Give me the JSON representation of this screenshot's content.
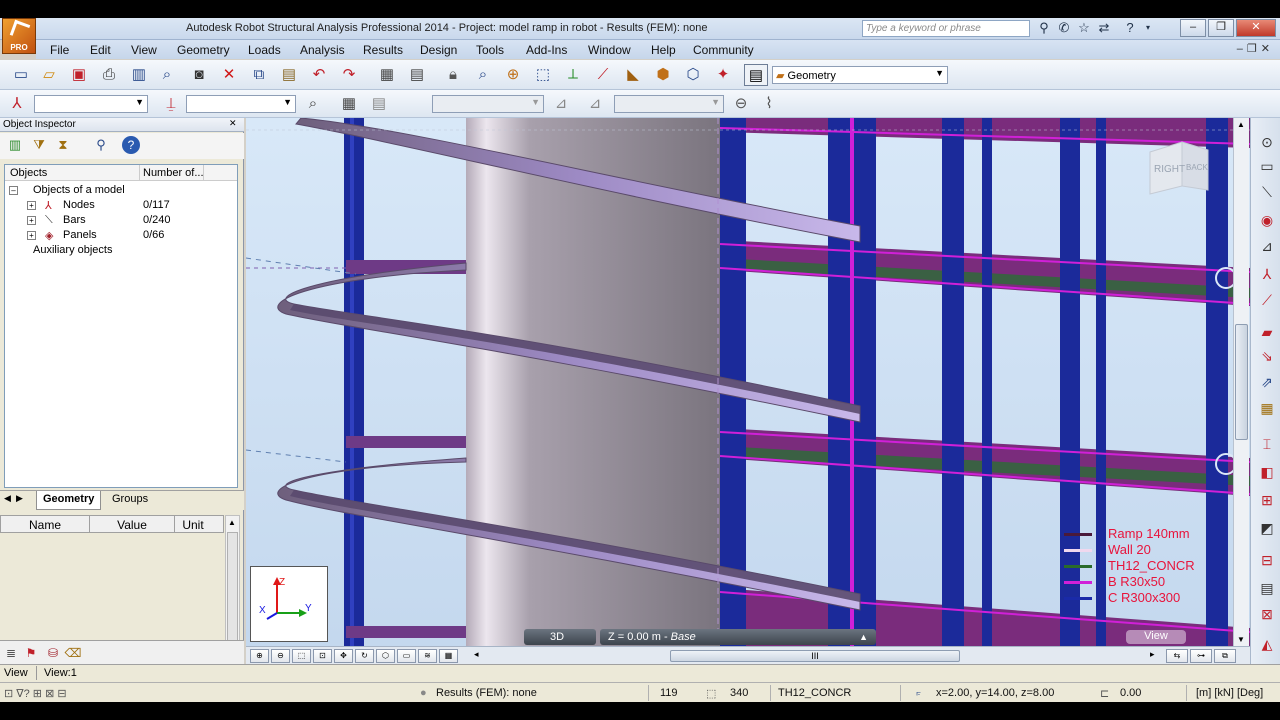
{
  "window": {
    "title": "Autodesk Robot Structural Analysis Professional 2014 - Project: model ramp in robot - Results (FEM): none",
    "logo_text": "PRO",
    "search_placeholder": "Type a keyword or phrase"
  },
  "menu": {
    "items": [
      "File",
      "Edit",
      "View",
      "Geometry",
      "Loads",
      "Analysis",
      "Results",
      "Design",
      "Tools",
      "Add-Ins",
      "Window",
      "Help",
      "Community"
    ]
  },
  "toolbar": {
    "layout_dropdown": "Geometry"
  },
  "inspector": {
    "title": "Object Inspector",
    "columns": [
      "Objects",
      "Number of..."
    ],
    "root": "Objects of a model",
    "rows": [
      {
        "label": "Nodes",
        "count": "0/117"
      },
      {
        "label": "Bars",
        "count": "0/240"
      },
      {
        "label": "Panels",
        "count": "0/66"
      }
    ],
    "auxiliary": "Auxiliary objects",
    "tabs": [
      "Geometry",
      "Groups"
    ],
    "props_columns": [
      "Name",
      "Value",
      "Unit"
    ]
  },
  "viewport": {
    "cube_faces": [
      "RIGHT",
      "BACK"
    ],
    "axes": {
      "z": "Z",
      "y": "Y",
      "x": "X"
    },
    "legend": [
      {
        "label": "Ramp 140mm",
        "color": "#4a1a3a"
      },
      {
        "label": "Wall 20",
        "color": "#f0d8ee"
      },
      {
        "label": "TH12_CONCR",
        "color": "#2a6a2a"
      },
      {
        "label": "B R30x50",
        "color": "#d020d8"
      },
      {
        "label": "C R300x300",
        "color": "#1a2aa8"
      }
    ],
    "mode_label": "3D",
    "plane_label": "Z = 0.00 m - ",
    "plane_name": "Base",
    "view_button": "View",
    "scroll_grip": "III"
  },
  "view_tabs": [
    "View",
    "View:1"
  ],
  "status": {
    "results": "Results (FEM): none",
    "node_count": "119",
    "bar_count": "340",
    "material": "TH12_CONCR",
    "coords": "x=2.00, y=14.00, z=8.00",
    "angle": "0.00",
    "units": "[m] [kN] [Deg]"
  },
  "colors": {
    "column": "#1b2a9a",
    "slab": "#8a3a8a",
    "ramp": "#8e7bb8",
    "wall": "#8c8592",
    "background": "#cfe0f2",
    "legend_text": "#e8143c"
  }
}
